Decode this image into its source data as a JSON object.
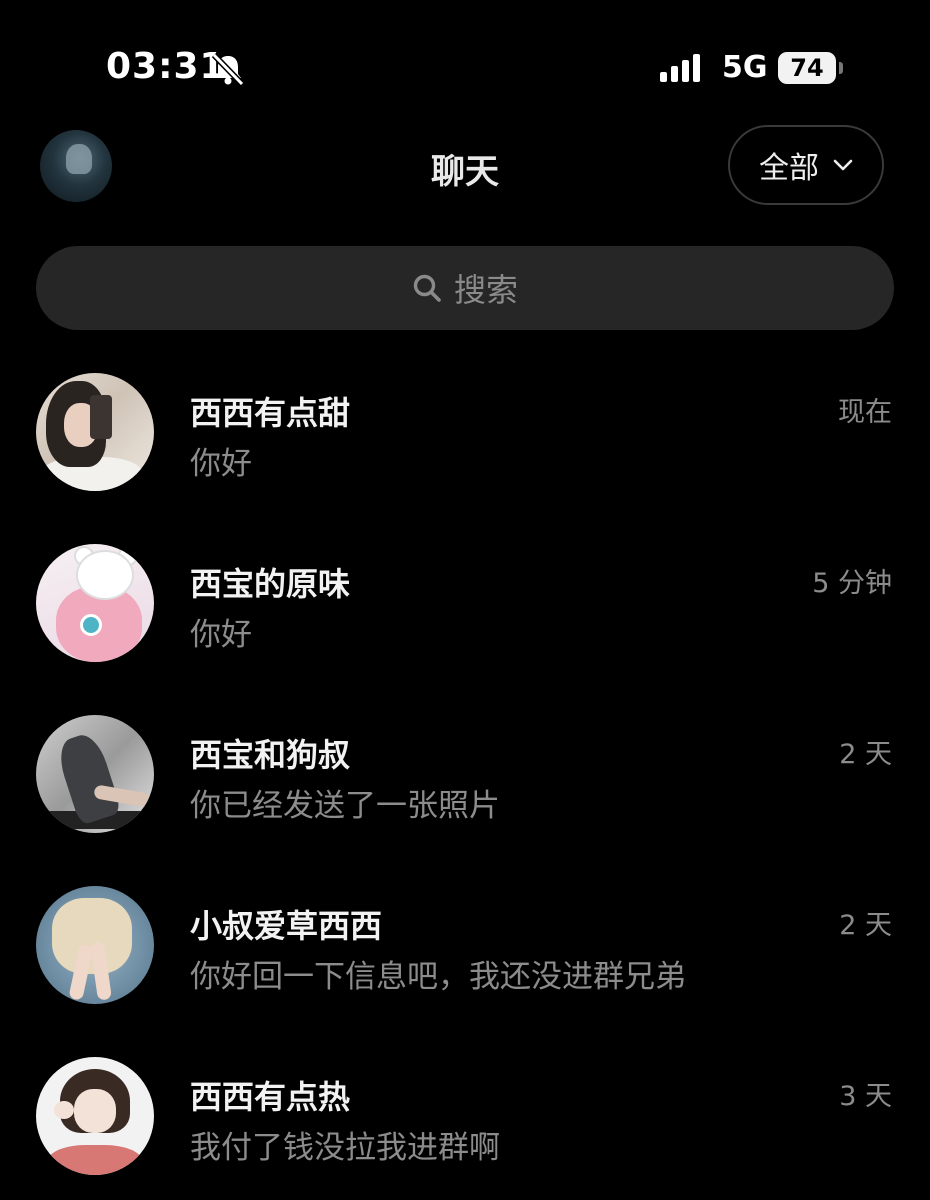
{
  "status_bar": {
    "time": "03:31",
    "network": "5G",
    "battery": "74",
    "icons": [
      "bell-slash-icon",
      "cellular-signal-icon",
      "battery-icon"
    ]
  },
  "header": {
    "title": "聊天",
    "filter_label": "全部",
    "icons": [
      "chevron-down-icon"
    ]
  },
  "search": {
    "placeholder": "搜索",
    "icon": "search-icon"
  },
  "chats": [
    {
      "name": "西西有点甜",
      "preview": "你好",
      "time": "现在"
    },
    {
      "name": "西宝的原味",
      "preview": "你好",
      "time": "5 分钟"
    },
    {
      "name": "西宝和狗叔",
      "preview": "你已经发送了一张照片",
      "time": "2 天"
    },
    {
      "name": "小叔爱草西西",
      "preview": "你好回一下信息吧，我还没进群兄弟",
      "time": "2 天"
    },
    {
      "name": "西西有点热",
      "preview": "我付了钱没拉我进群啊",
      "time": "3 天"
    }
  ],
  "colors": {
    "background": "#000000",
    "search_bg": "#262626",
    "secondary_text": "#8c8c8c"
  }
}
